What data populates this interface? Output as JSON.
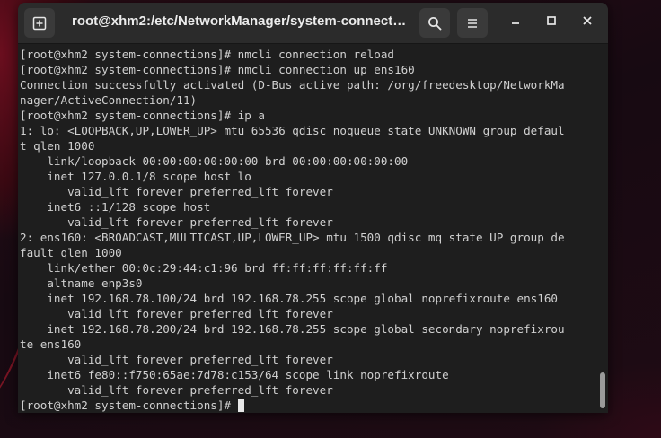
{
  "window": {
    "title": "root@xhm2:/etc/NetworkManager/system-connect…"
  },
  "icons": {
    "new_tab": "new-tab-icon",
    "search": "search-icon",
    "menu": "hamburger-menu-icon",
    "minimize": "minimize-icon",
    "maximize": "maximize-icon",
    "close": "close-icon"
  },
  "terminal": {
    "lines": [
      "[root@xhm2 system-connections]# nmcli connection reload",
      "[root@xhm2 system-connections]# nmcli connection up ens160",
      "Connection successfully activated (D-Bus active path: /org/freedesktop/NetworkMa",
      "nager/ActiveConnection/11)",
      "[root@xhm2 system-connections]# ip a",
      "1: lo: <LOOPBACK,UP,LOWER_UP> mtu 65536 qdisc noqueue state UNKNOWN group defaul",
      "t qlen 1000",
      "    link/loopback 00:00:00:00:00:00 brd 00:00:00:00:00:00",
      "    inet 127.0.0.1/8 scope host lo",
      "       valid_lft forever preferred_lft forever",
      "    inet6 ::1/128 scope host",
      "       valid_lft forever preferred_lft forever",
      "2: ens160: <BROADCAST,MULTICAST,UP,LOWER_UP> mtu 1500 qdisc mq state UP group de",
      "fault qlen 1000",
      "    link/ether 00:0c:29:44:c1:96 brd ff:ff:ff:ff:ff:ff",
      "    altname enp3s0",
      "    inet 192.168.78.100/24 brd 192.168.78.255 scope global noprefixroute ens160",
      "       valid_lft forever preferred_lft forever",
      "    inet 192.168.78.200/24 brd 192.168.78.255 scope global secondary noprefixrou",
      "te ens160",
      "       valid_lft forever preferred_lft forever",
      "    inet6 fe80::f750:65ae:7d78:c153/64 scope link noprefixroute",
      "       valid_lft forever preferred_lft forever"
    ],
    "prompt": "[root@xhm2 system-connections]#"
  },
  "colors": {
    "terminal_bg": "#1e1e1e",
    "terminal_fg": "#d0d0d0",
    "titlebar_bg": "#2b2b2b",
    "desktop_accent": "#6a0e1e"
  }
}
